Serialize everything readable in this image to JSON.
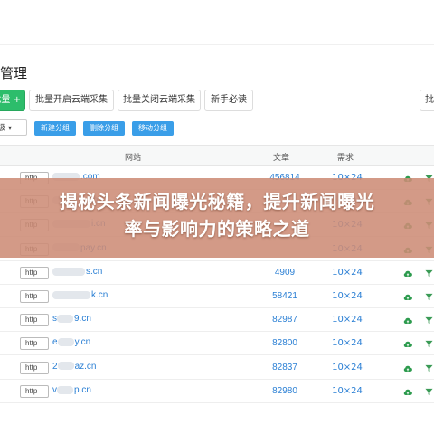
{
  "page": {
    "title": "管理"
  },
  "toolbar": {
    "add_label": "批量 +",
    "btn_open_collect": "批量开启云端采集",
    "btn_close_collect": "批量关闭云端采集",
    "btn_newbie": "新手必读",
    "btn_right": "批"
  },
  "group_bar": {
    "select_value": "级",
    "new_group": "新建分组",
    "delete_group": "删除分组",
    "move_group": "移动分组"
  },
  "table": {
    "headers": {
      "site": "网站",
      "articles": "文章",
      "requests": "需求"
    },
    "rows": [
      {
        "protocol": "http",
        "domain_suffix": ".com",
        "articles": "456814",
        "requests": "10×24"
      },
      {
        "protocol": "http",
        "domain_suffix": ".cn",
        "articles": "",
        "requests": "10×24"
      },
      {
        "protocol": "http",
        "domain_suffix": "i.cn",
        "articles": "",
        "requests": "10×24"
      },
      {
        "protocol": "http",
        "domain_suffix": "pay.cn",
        "articles": "",
        "requests": "10×24"
      },
      {
        "protocol": "http",
        "domain_suffix": "s.cn",
        "articles": "4909",
        "requests": "10×24"
      },
      {
        "protocol": "http",
        "domain_suffix": "k.cn",
        "articles": "58421",
        "requests": "10×24"
      },
      {
        "protocol": "http",
        "domain_prefix": "s",
        "domain_suffix": "9.cn",
        "articles": "82987",
        "requests": "10×24"
      },
      {
        "protocol": "http",
        "domain_prefix": "e",
        "domain_suffix": "y.cn",
        "articles": "82800",
        "requests": "10×24"
      },
      {
        "protocol": "http",
        "domain_prefix": "2",
        "domain_suffix": "az.cn",
        "articles": "82837",
        "requests": "10×24"
      },
      {
        "protocol": "http",
        "domain_prefix": "v",
        "domain_suffix": "p.cn",
        "articles": "82980",
        "requests": "10×24"
      }
    ]
  },
  "banner": {
    "line1": "揭秘头条新闻曝光秘籍，提升新闻曝光",
    "line2": "率与影响力的策略之道"
  },
  "icons": {
    "cloud": "cloud-upload-icon",
    "filter": "filter-icon"
  },
  "colors": {
    "accent_blue": "#3a9ee8",
    "link_blue": "#2a7fd4",
    "green": "#2dbd6b",
    "banner": "#cd8c76"
  }
}
